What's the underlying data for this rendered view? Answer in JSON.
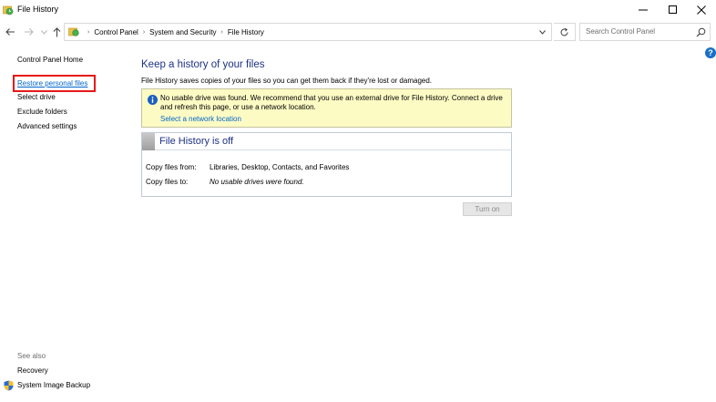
{
  "window": {
    "title": "File History"
  },
  "navigation": {
    "breadcrumbs": [
      "Control Panel",
      "System and Security",
      "File History"
    ],
    "search_placeholder": "Search Control Panel"
  },
  "left_pane": {
    "home": "Control Panel Home",
    "links": [
      "Restore personal files",
      "Select drive",
      "Exclude folders",
      "Advanced settings"
    ],
    "see_also": "See also",
    "see_also_links": [
      "Recovery",
      "System Image Backup"
    ]
  },
  "main": {
    "title": "Keep a history of your files",
    "description": "File History saves copies of your files so you can get them back if they're lost or damaged.",
    "info": {
      "text": "No usable drive was found. We recommend that you use an external drive for File History. Connect a drive and refresh this page, or use a network location.",
      "link": "Select a network location"
    },
    "status": {
      "title": "File History is off",
      "rows": [
        {
          "label": "Copy files from:",
          "value": "Libraries, Desktop, Contacts, and Favorites"
        },
        {
          "label": "Copy files to:",
          "value": "No usable drives were found."
        }
      ]
    },
    "turn_on_label": "Turn on"
  },
  "colors": {
    "link": "#0066cc",
    "heading": "#1e3287",
    "info_background": "#fdfbc4",
    "highlight": "#e81818"
  }
}
